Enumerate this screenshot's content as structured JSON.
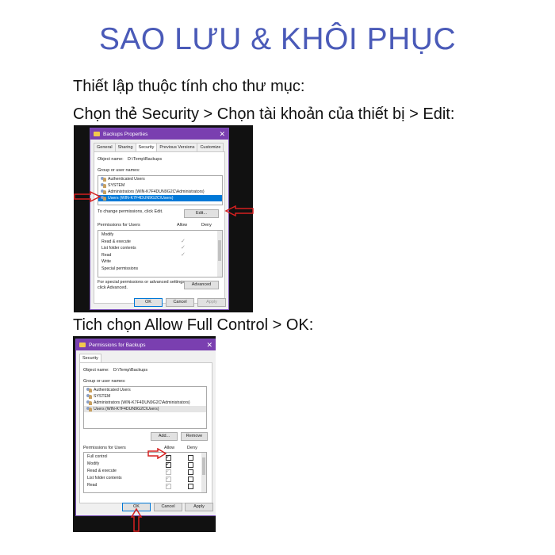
{
  "title": "SAO LƯU & KHÔI PHỤC",
  "instructions": {
    "line1": "Thiết lập thuộc tính cho thư mục:",
    "line2": "Chọn thẻ Security > Chọn tài khoản của thiết bị > Edit:",
    "line3": "Tich chọn Allow Full Control > OK:"
  },
  "dialog1": {
    "window_title": "Backups Properties",
    "close_label": "✕",
    "tabs": [
      "General",
      "Sharing",
      "Security",
      "Previous Versions",
      "Customize"
    ],
    "active_tab": "Security",
    "object_name_label": "Object name:",
    "object_name_value": "D:\\Temp\\Backups",
    "group_label": "Group or user names:",
    "users": [
      "Authenticated Users",
      "SYSTEM",
      "Administrators (WIN-K7F4DUN9G2C\\Administrators)",
      "Users (WIN-K7F4DUN9G2C\\Users)"
    ],
    "selected_user_index": 3,
    "change_perm_text": "To change permissions, click Edit.",
    "edit_button": "Edit...",
    "permissions_label": "Permissions for Users",
    "allow_header": "Allow",
    "deny_header": "Deny",
    "permissions": [
      {
        "name": "Modify",
        "allow": false
      },
      {
        "name": "Read & execute",
        "allow": true
      },
      {
        "name": "List folder contents",
        "allow": true
      },
      {
        "name": "Read",
        "allow": true
      },
      {
        "name": "Write",
        "allow": false
      },
      {
        "name": "Special permissions",
        "allow": false
      }
    ],
    "advanced_text_1": "For special permissions or advanced settings,",
    "advanced_text_2": "click Advanced.",
    "advanced_button": "Advanced",
    "ok_button": "OK",
    "cancel_button": "Cancel",
    "apply_button": "Apply"
  },
  "dialog2": {
    "window_title": "Permissions for Backups",
    "close_label": "✕",
    "tab": "Security",
    "object_name_label": "Object name:",
    "object_name_value": "D:\\Temp\\Backups",
    "group_label": "Group or user names:",
    "users": [
      "Authenticated Users",
      "SYSTEM",
      "Administrators (WIN-K7F4DUN9G2C\\Administrators)",
      "Users (WIN-K7F4DUN9G2C\\Users)"
    ],
    "selected_user_index": 3,
    "add_button": "Add...",
    "remove_button": "Remove",
    "permissions_label": "Permissions for Users",
    "allow_header": "Allow",
    "deny_header": "Deny",
    "permissions": [
      {
        "name": "Full control",
        "allow": true,
        "allow_grey": false,
        "deny": false
      },
      {
        "name": "Modify",
        "allow": true,
        "allow_grey": false,
        "deny": false
      },
      {
        "name": "Read & execute",
        "allow": true,
        "allow_grey": true,
        "deny": false
      },
      {
        "name": "List folder contents",
        "allow": true,
        "allow_grey": true,
        "deny": false
      },
      {
        "name": "Read",
        "allow": true,
        "allow_grey": true,
        "deny": false
      }
    ],
    "ok_button": "OK",
    "cancel_button": "Cancel",
    "apply_button": "Apply"
  },
  "colors": {
    "title": "#4a5ab8",
    "titlebar": "#7a3fb0",
    "selection": "#0078d7",
    "annotation_arrow": "#d62020"
  }
}
